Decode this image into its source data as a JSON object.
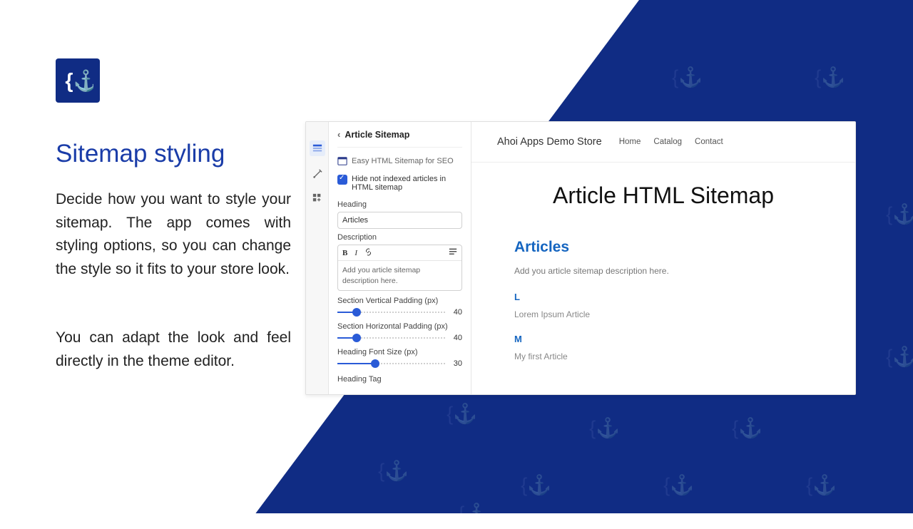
{
  "left": {
    "title": "Sitemap styling",
    "para1": "Decide how you want to style your sitemap. The app comes with styling options, so you can change the style so it fits to your store look.",
    "para2": "You can adapt the look and feel directly in the theme editor."
  },
  "panel": {
    "title": "Article Sitemap",
    "app_name": "Easy HTML Sitemap for SEO",
    "checkbox_label": "Hide not indexed articles in HTML sitemap",
    "heading_label": "Heading",
    "heading_value": "Articles",
    "description_label": "Description",
    "description_placeholder": "Add you article sitemap description here.",
    "sliders": [
      {
        "label": "Section Vertical Padding (px)",
        "value": 40,
        "pct": 18
      },
      {
        "label": "Section Horizontal Padding (px)",
        "value": 40,
        "pct": 18
      },
      {
        "label": "Heading Font Size (px)",
        "value": 30,
        "pct": 35
      }
    ],
    "heading_tag_label": "Heading Tag"
  },
  "preview": {
    "store_title": "Ahoi Apps Demo Store",
    "nav": [
      "Home",
      "Catalog",
      "Contact"
    ],
    "h1": "Article HTML Sitemap",
    "h2": "Articles",
    "desc": "Add you article sitemap description here.",
    "groups": [
      {
        "letter": "L",
        "items": [
          "Lorem Ipsum Article"
        ]
      },
      {
        "letter": "M",
        "items": [
          "My first Article"
        ]
      }
    ]
  }
}
